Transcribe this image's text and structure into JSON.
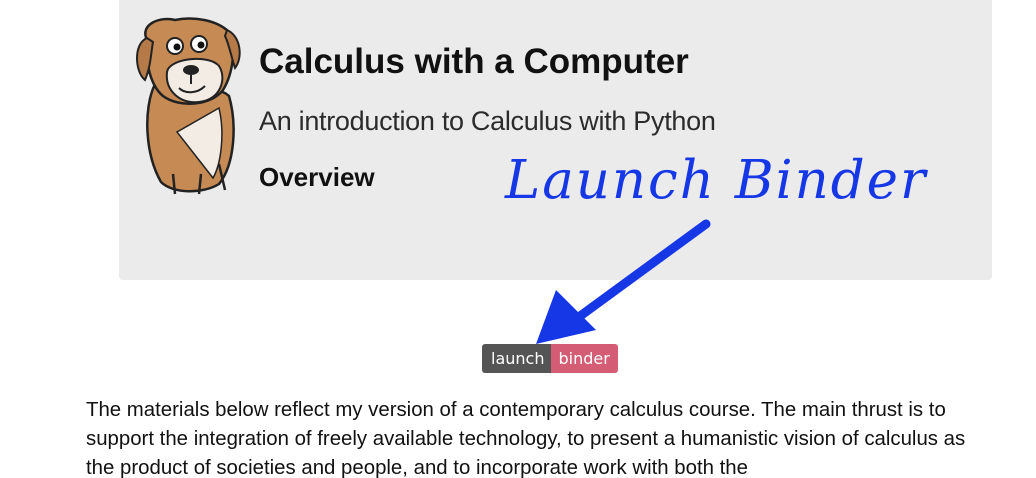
{
  "hero": {
    "title": "Calculus with a Computer",
    "subtitle": "An introduction to Calculus with Python",
    "overview_link": "Overview",
    "logo_icon": "cartoon-dog-logo"
  },
  "annotation": {
    "text": "Launch Binder",
    "color": "#1637e6",
    "arrow_icon": "arrow-down-left-icon"
  },
  "badge": {
    "left_label": "launch",
    "right_label": "binder",
    "left_color": "#555555",
    "right_color": "#d45c75"
  },
  "intro": {
    "paragraph": "The materials below reflect my version of a contemporary calculus course. The main thrust is to support the integration of freely available technology, to present a humanistic vision of calculus as the product of societies and people, and to incorporate work with both the"
  }
}
